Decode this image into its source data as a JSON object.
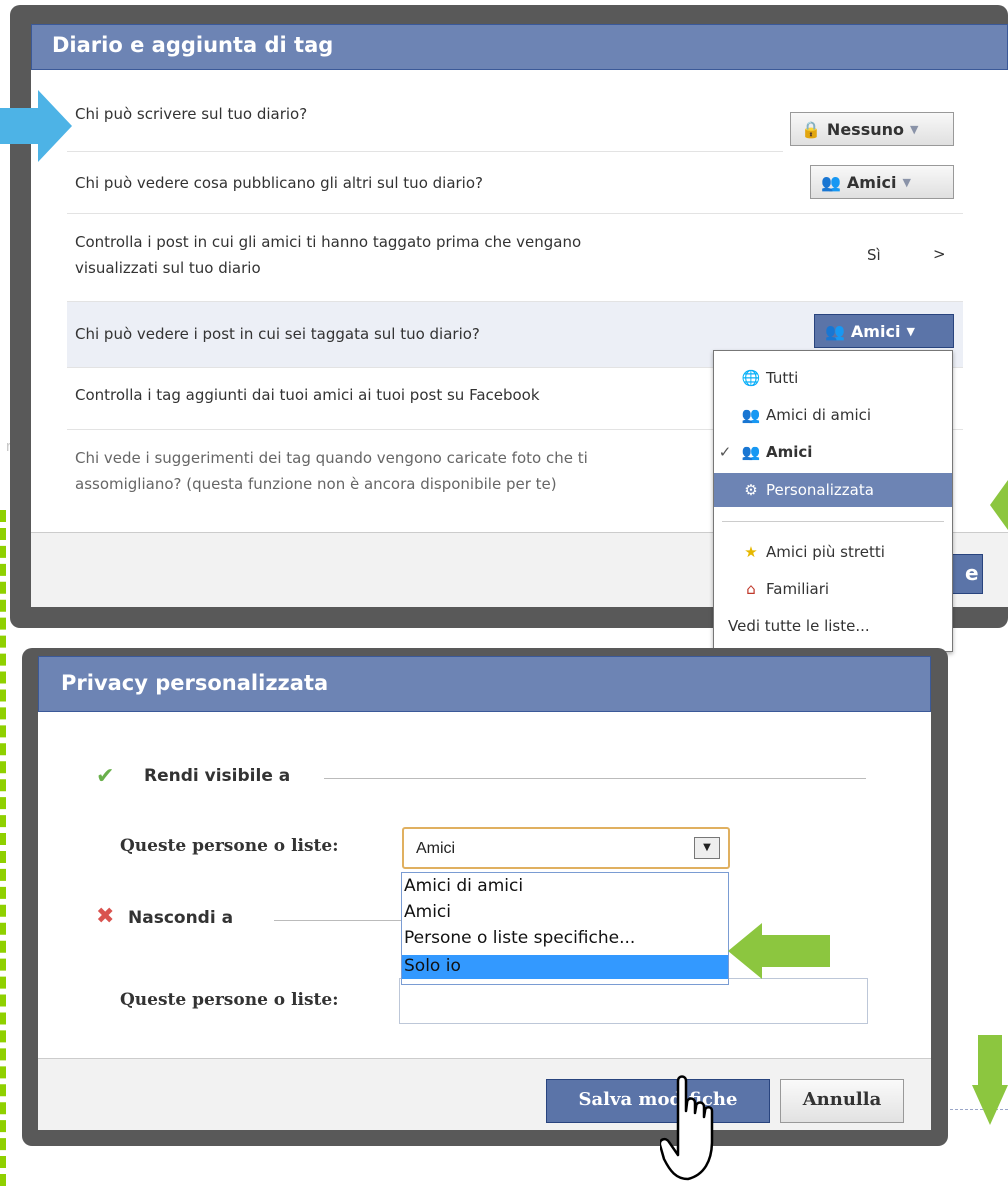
{
  "dialog1": {
    "title": "Diario e aggiunta di tag",
    "rows": [
      {
        "label": "Chi può scrivere sul tuo diario?",
        "control": "Nessuno"
      },
      {
        "label": "Chi può vedere cosa pubblicano gli altri sul tuo diario?",
        "control": "Amici"
      },
      {
        "label_line1": "Controlla i post in cui gli amici ti hanno taggato prima che vengano",
        "label_line2": "visualizzati sul tuo diario",
        "control": "Sì",
        "chevron": ">"
      },
      {
        "label": "Chi può vedere i post in cui sei taggata sul tuo diario?",
        "control": "Amici"
      },
      {
        "label": "Controlla i tag aggiunti dai tuoi amici ai tuoi post su Facebook"
      },
      {
        "label_line1": "Chi vede i suggerimenti dei tag quando vengono caricate foto che ti",
        "label_line2": "assomigliano? (questa funzione non è ancora disponibile per te)"
      }
    ],
    "footer_button_fragment": "e"
  },
  "audience_menu": {
    "items": [
      {
        "label": "Tutti",
        "icon": "globe-icon"
      },
      {
        "label": "Amici di amici",
        "icon": "friends-of-friends-icon"
      },
      {
        "label": "Amici",
        "icon": "friends-icon",
        "checked": true
      },
      {
        "label": "Personalizzata",
        "icon": "gear-icon",
        "active": true
      },
      {
        "label": "Amici più stretti",
        "icon": "star-list-icon"
      },
      {
        "label": "Familiari",
        "icon": "house-list-icon"
      },
      {
        "label": "Vedi tutte le liste..."
      }
    ]
  },
  "dialog2": {
    "title": "Privacy personalizzata",
    "show_section": "Rendi visibile a",
    "hide_section": "Nascondi a",
    "people_label": "Queste persone o liste:",
    "select_value": "Amici",
    "options": [
      "Amici di amici",
      "Amici",
      "Persone o liste specifiche...",
      "Solo io"
    ],
    "save_label": "Salva modifiche",
    "cancel_label": "Annulla"
  },
  "colors": {
    "header_blue": "#6d84b4",
    "arrow_blue": "#4db3e6",
    "arrow_green": "#8cc63f",
    "selected_option": "#3399ff"
  }
}
